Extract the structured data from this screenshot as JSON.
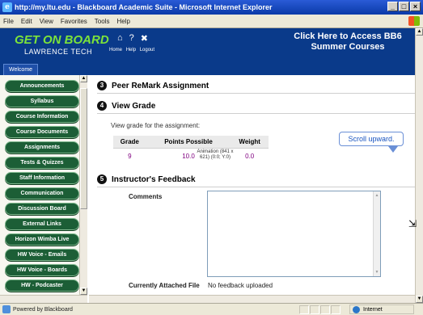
{
  "window": {
    "title": "http://my.ltu.edu - Blackboard Academic Suite - Microsoft Internet Explorer",
    "controls": [
      "_",
      "□",
      "×"
    ]
  },
  "menu": [
    "File",
    "Edit",
    "View",
    "Favorites",
    "Tools",
    "Help"
  ],
  "banner": {
    "logo_line1": "GET ON BOARD",
    "logo_line2": "LAWRENCE TECH",
    "top_links": [
      "Home",
      "Help",
      "Logout"
    ],
    "promo": "Click Here to Access BB6 Summer Courses",
    "welcome_tab": "Welcome"
  },
  "sidebar": {
    "items": [
      "Announcements",
      "Syllabus",
      "Course Information",
      "Course Documents",
      "Assignments",
      "Tests & Quizzes",
      "Staff Information",
      "Communication",
      "Discussion Board",
      "External Links",
      "Horizon Wimba Live",
      "HW Voice - Emails",
      "HW Voice - Boards",
      "HW - Podcaster"
    ],
    "nav_color": "#1c5e36"
  },
  "main": {
    "section3": {
      "num": "3",
      "title": "Peer ReMark Assignment"
    },
    "section4": {
      "num": "4",
      "title": "View Grade",
      "desc": "View grade for the assignment:",
      "columns": [
        "Grade",
        "Points Possible",
        "Weight"
      ],
      "row": [
        "9",
        "10.0",
        "0.0"
      ]
    },
    "animation_note": "Animation (841 x 621) (0:0; Y:0)",
    "callout": "Scroll upward.",
    "section5": {
      "num": "5",
      "title": "Instructor's Feedback",
      "comments_label": "Comments",
      "attached_label": "Currently Attached File",
      "attached_value": "No feedback uploaded"
    }
  },
  "status": {
    "text": "Powered by Blackboard",
    "zone": "Internet"
  }
}
